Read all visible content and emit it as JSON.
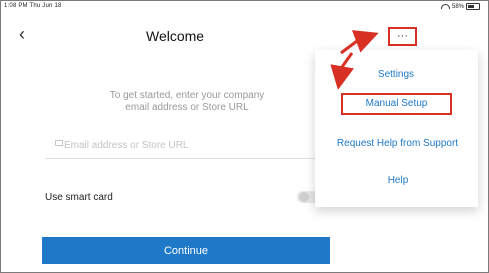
{
  "status_bar": {
    "time": "1:08 PM  Thu Jun 18",
    "battery": "58%"
  },
  "header": {
    "title": "Welcome",
    "more_button": "···"
  },
  "content": {
    "intro_line_1": "To get started, enter your company",
    "intro_line_2": "email address or Store URL",
    "email_placeholder": "Email address or Store URL",
    "smart_card_label": "Use smart card",
    "continue_label": "Continue"
  },
  "menu": {
    "settings": "Settings",
    "manual_setup": "Manual Setup",
    "support": "Request Help from Support",
    "help": "Help"
  },
  "icons": {
    "back": "chevron-left-icon",
    "more": "ellipsis-icon",
    "mail": "mail-icon",
    "wifi": "wifi-icon",
    "battery": "battery-icon"
  },
  "colors": {
    "accent": "#1f79c8",
    "annotation": "#d93025"
  }
}
